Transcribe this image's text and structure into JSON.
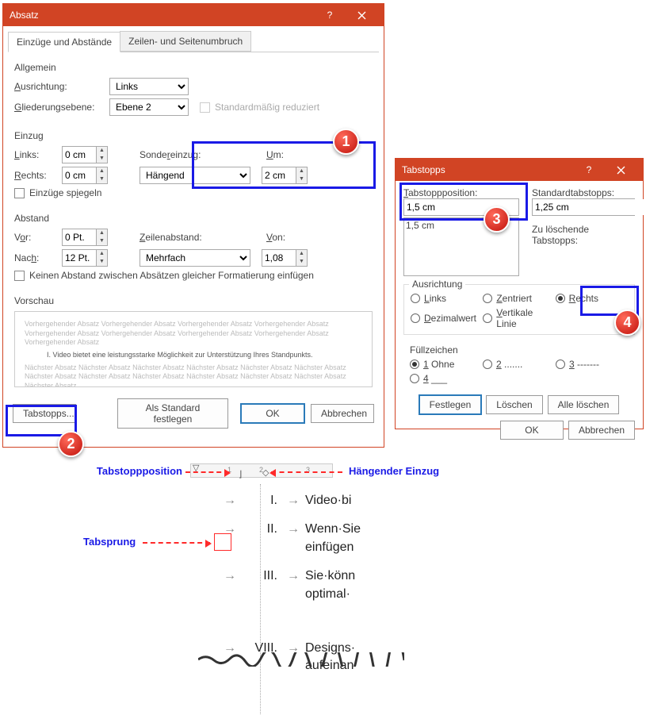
{
  "dialog1": {
    "title": "Absatz",
    "tabs": [
      "Einzüge und Abstände",
      "Zeilen- und Seitenumbruch"
    ],
    "allgemein": {
      "title": "Allgemein",
      "ausrichtung_label": "Ausrichtung:",
      "ausrichtung_value": "Links",
      "gliederung_label": "Gliederungsebene:",
      "gliederung_value": "Ebene 2",
      "standard_reduziert": "Standardmäßig reduziert"
    },
    "einzug": {
      "title": "Einzug",
      "links_label": "Links:",
      "links_value": "0 cm",
      "rechts_label": "Rechts:",
      "rechts_value": "0 cm",
      "sondereinzug_label": "Sondereinzug:",
      "sondereinzug_value": "Hängend",
      "um_label": "Um:",
      "um_value": "2 cm",
      "spiegeln": "Einzüge spiegeln"
    },
    "abstand": {
      "title": "Abstand",
      "vor_label": "Vor:",
      "vor_value": "0 Pt.",
      "nach_label": "Nach:",
      "nach_value": "12 Pt.",
      "zeilen_label": "Zeilenabstand:",
      "zeilen_value": "Mehrfach",
      "von_label": "Von:",
      "von_value": "1,08",
      "kein_abstand": "Keinen Abstand zwischen Absätzen gleicher Formatierung einfügen"
    },
    "vorschau": {
      "title": "Vorschau",
      "filler": "Vorhergehender Absatz Vorhergehender Absatz Vorhergehender Absatz Vorhergehender Absatz Vorhergehender Absatz Vorhergehender Absatz Vorhergehender Absatz Vorhergehender Absatz Vorhergehender Absatz",
      "main": "I.  Video bietet eine leistungsstarke Möglichkeit zur Unterstützung Ihres Standpunkts.",
      "filler2": "Nächster Absatz Nächster Absatz Nächster Absatz Nächster Absatz Nächster Absatz Nächster Absatz Nächster Absatz Nächster Absatz Nächster Absatz Nächster Absatz Nächster Absatz Nächster Absatz Nächster Absatz"
    },
    "buttons": {
      "tabstopps": "Tabstopps...",
      "standard": "Als Standard festlegen",
      "ok": "OK",
      "cancel": "Abbrechen"
    }
  },
  "dialog2": {
    "title": "Tabstopps",
    "pos_label": "Tabstoppposition:",
    "pos_value": "1,5 cm",
    "list_item": "1,5 cm",
    "std_label": "Standardtabstopps:",
    "std_value": "1,25 cm",
    "clear_label": "Zu löschende Tabstopps:",
    "ausrichtung": {
      "title": "Ausrichtung",
      "links": "Links",
      "zentriert": "Zentriert",
      "rechts": "Rechts",
      "dezimal": "Dezimalwert",
      "vline": "Vertikale Linie"
    },
    "fuell": {
      "title": "Füllzeichen",
      "o1": "1 Ohne",
      "o2": "2 .......",
      "o3": "3 -------",
      "o4": "4 ___"
    },
    "buttons": {
      "set": "Festlegen",
      "del": "Löschen",
      "delall": "Alle löschen",
      "ok": "OK",
      "cancel": "Abbrechen"
    }
  },
  "annotations": {
    "tabpos": "Tabstoppposition",
    "haengend": "Hängender Einzug",
    "tabsprung": "Tabsprung"
  },
  "list_preview": [
    {
      "num": "I.",
      "text": "Video·bi"
    },
    {
      "num": "II.",
      "text": "Wenn·Sie einfügen"
    },
    {
      "num": "III.",
      "text": "Sie·könn optimal·"
    },
    {
      "num": "VIII.",
      "text": "Designs· aufeinan"
    }
  ],
  "ruler_numbers": [
    "1",
    "2",
    "3"
  ]
}
